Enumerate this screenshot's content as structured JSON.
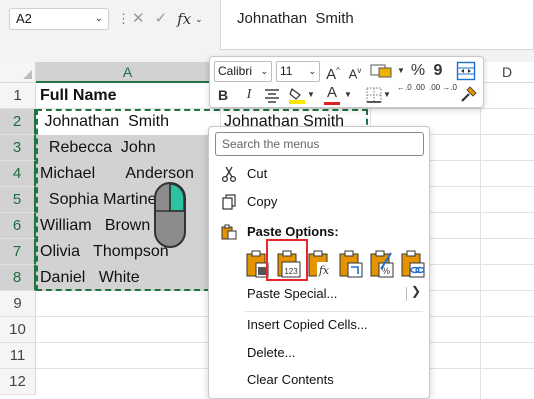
{
  "formula_bar": {
    "name_box": "A2",
    "fx": "fx",
    "content": "Johnathan  Smith"
  },
  "columns": [
    "A",
    "B",
    "D"
  ],
  "rows": [
    "1",
    "2",
    "3",
    "4",
    "5",
    "6",
    "7",
    "8",
    "9",
    "10",
    "11",
    "12"
  ],
  "cells": {
    "a1": "Full Name",
    "a2": " Johnathan  Smith",
    "a3": "  Rebecca  John",
    "a4": "Michael       Anderson",
    "a5": "  Sophia Martinez",
    "a6": "William   Brown",
    "a7": "Olivia   Thompson",
    "a8": "Daniel   White",
    "b2": "Johnathan Smith"
  },
  "mini_toolbar": {
    "font": "Calibri",
    "size": "11",
    "grow_font": "A",
    "shrink_font": "A",
    "percent": "%",
    "comma": "9",
    "bold": "B",
    "italic": "I",
    "font_color_letter": "A",
    "decrease_decimal": "←.0 .00",
    "increase_decimal": ".00 →.0"
  },
  "context_menu": {
    "search_placeholder": "Search the menus",
    "cut": "Cut",
    "copy": "Copy",
    "paste_options": "Paste Options:",
    "paste_special": "Paste Special...",
    "insert_copied": "Insert Copied Cells...",
    "delete": "Delete...",
    "clear_contents": "Clear Contents"
  },
  "colors": {
    "excel_green": "#217346",
    "selection_gray": "#d2d2d2",
    "highlight_red": "#e8262b",
    "clipboard_orange": "#e59400",
    "font_color_red": "#e02020",
    "highlight_yellow": "#ffe600"
  },
  "icons": [
    "cut-icon",
    "copy-icon",
    "paste-icon",
    "mouse-icon",
    "format-painter-icon",
    "fill-color-icon",
    "borders-icon"
  ]
}
